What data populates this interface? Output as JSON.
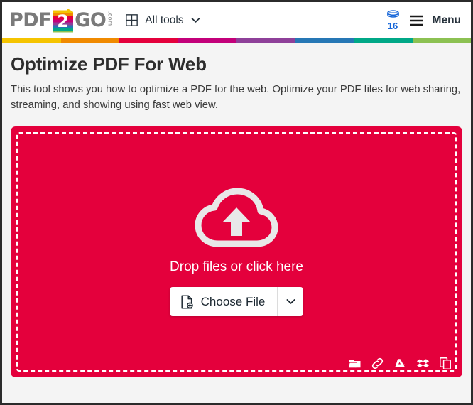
{
  "header": {
    "logo": {
      "pdf_text": "PDF",
      "doc_number": "2",
      "go_text": "GO",
      "com_text": ".com",
      "icon": "pdf2go-logo-icon"
    },
    "all_tools": {
      "label": "All tools",
      "grid_icon": "grid-icon",
      "chevron_icon": "chevron-down-icon"
    },
    "credits": {
      "icon": "coin-icon",
      "count": "16"
    },
    "menu": {
      "burger_icon": "hamburger-menu-icon",
      "label": "Menu"
    },
    "stripe_colors": [
      "#f5c400",
      "#f08a00",
      "#e4003c",
      "#c3007a",
      "#8e4099",
      "#2677b5",
      "#00a887",
      "#8cc152"
    ]
  },
  "main": {
    "title": "Optimize PDF For Web",
    "description": "This tool shows you how to optimize a PDF for the web. Optimize your PDF files for web sharing, streaming, and showing using fast web view.",
    "dropzone": {
      "cloud_icon": "cloud-upload-icon",
      "drop_text": "Drop files or click here",
      "choose_file_label": "Choose File",
      "choose_file_icon": "file-add-icon",
      "caret_icon": "chevron-down-icon",
      "accent_color": "#e4003c",
      "sources": [
        {
          "name": "folder-icon",
          "label": "My Device"
        },
        {
          "name": "link-icon",
          "label": "From URL"
        },
        {
          "name": "google-drive-icon",
          "label": "Google Drive"
        },
        {
          "name": "dropbox-icon",
          "label": "Dropbox"
        },
        {
          "name": "copy-paste-icon",
          "label": "Clipboard"
        }
      ]
    }
  }
}
